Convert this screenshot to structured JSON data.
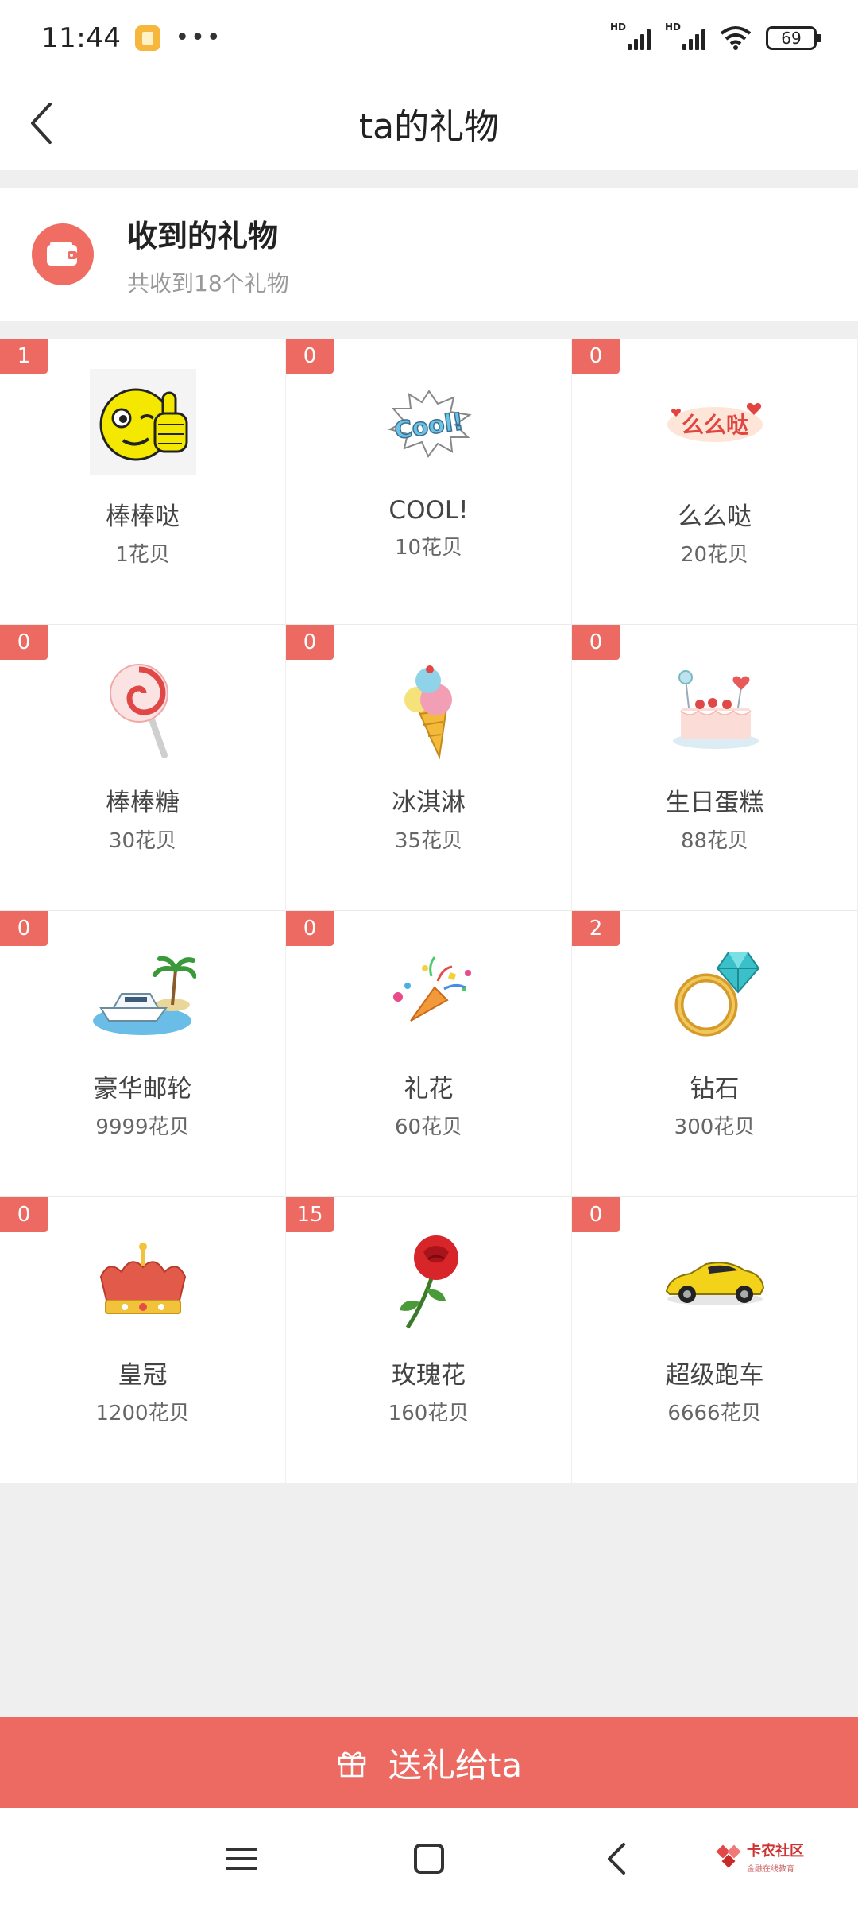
{
  "status_bar": {
    "time": "11:44",
    "dots": "•••",
    "signal_label_1": "HD",
    "signal_label_2": "HD",
    "battery": "69"
  },
  "header": {
    "title": "ta的礼物"
  },
  "summary": {
    "title": "收到的礼物",
    "subtitle": "共收到18个礼物"
  },
  "gifts": [
    {
      "count": "1",
      "name": "棒棒哒",
      "price": "1花贝",
      "icon": "thumbs-up-smiley"
    },
    {
      "count": "0",
      "name": "COOL!",
      "price": "10花贝",
      "icon": "cool-text-burst"
    },
    {
      "count": "0",
      "name": "么么哒",
      "price": "20花贝",
      "icon": "kiss-text"
    },
    {
      "count": "0",
      "name": "棒棒糖",
      "price": "30花贝",
      "icon": "lollipop"
    },
    {
      "count": "0",
      "name": "冰淇淋",
      "price": "35花贝",
      "icon": "ice-cream"
    },
    {
      "count": "0",
      "name": "生日蛋糕",
      "price": "88花贝",
      "icon": "birthday-cake"
    },
    {
      "count": "0",
      "name": "豪华邮轮",
      "price": "9999花贝",
      "icon": "yacht"
    },
    {
      "count": "0",
      "name": "礼花",
      "price": "60花贝",
      "icon": "party-popper"
    },
    {
      "count": "2",
      "name": "钻石",
      "price": "300花贝",
      "icon": "diamond-ring"
    },
    {
      "count": "0",
      "name": "皇冠",
      "price": "1200花贝",
      "icon": "crown"
    },
    {
      "count": "15",
      "name": "玫瑰花",
      "price": "160花贝",
      "icon": "rose"
    },
    {
      "count": "0",
      "name": "超级跑车",
      "price": "6666花贝",
      "icon": "sports-car"
    }
  ],
  "send_button": {
    "label": "送礼给ta"
  },
  "watermark": {
    "main": "卡农社区",
    "sub": "金融在线教育"
  },
  "colors": {
    "accent": "#ec6a61",
    "background": "#efefef"
  }
}
